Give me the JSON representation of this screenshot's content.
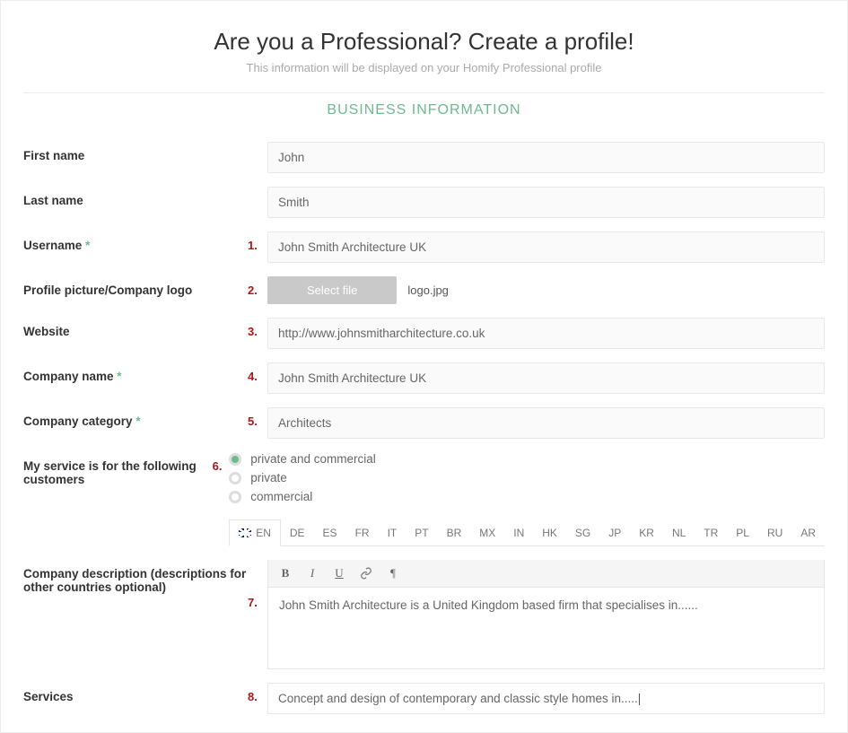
{
  "header": {
    "title": "Are you a Professional? Create a profile!",
    "subtitle": "This information will be displayed on your Homify Professional profile"
  },
  "section_title": "BUSINESS INFORMATION",
  "labels": {
    "first_name": "First name",
    "last_name": "Last name",
    "username": "Username",
    "profile_picture": "Profile picture/Company logo",
    "website": "Website",
    "company_name": "Company name",
    "company_category": "Company category",
    "service_customers": "My service is for the following customers",
    "company_description": "Company description (descriptions for other countries optional)",
    "services": "Services"
  },
  "numbers": {
    "n1": "1.",
    "n2": "2.",
    "n3": "3.",
    "n4": "4.",
    "n5": "5.",
    "n6": "6.",
    "n7": "7.",
    "n8": "8."
  },
  "values": {
    "first_name": "John",
    "last_name": "Smith",
    "username": "John Smith Architecture UK",
    "file_button": "Select file",
    "file_name": "logo.jpg",
    "website": "http://www.johnsmitharchitecture.co.uk",
    "company_name": "John Smith Architecture UK",
    "company_category": "Architects",
    "radios": {
      "opt1": "private and commercial",
      "opt2": "private",
      "opt3": "commercial"
    },
    "description": "John Smith Architecture is a United Kingdom based firm that specialises in......",
    "services": "Concept and design of contemporary and classic style homes in....."
  },
  "lang_tabs": {
    "t0": "EN",
    "t1": "DE",
    "t2": "ES",
    "t3": "FR",
    "t4": "IT",
    "t5": "PT",
    "t6": "BR",
    "t7": "MX",
    "t8": "IN",
    "t9": "HK",
    "t10": "SG",
    "t11": "JP",
    "t12": "KR",
    "t13": "NL",
    "t14": "TR",
    "t15": "PL",
    "t16": "RU",
    "t17": "AR"
  },
  "toolbar": {
    "bold": "B",
    "italic": "I",
    "underline": "U",
    "link": "🔗",
    "para": "¶"
  }
}
